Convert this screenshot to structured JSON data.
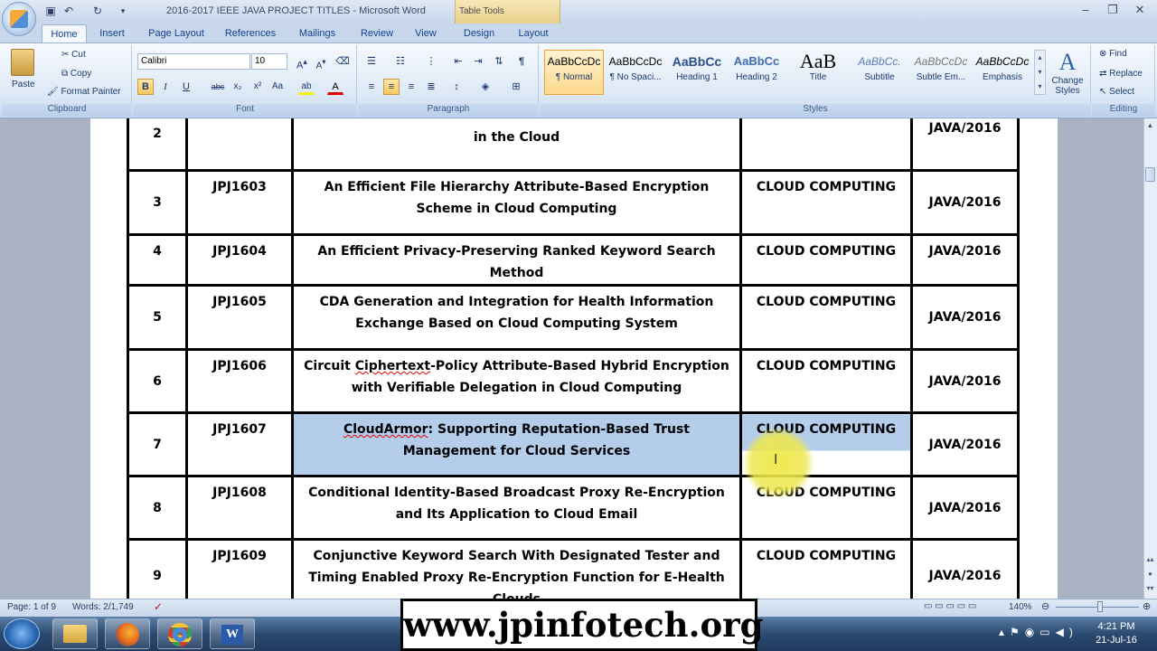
{
  "window": {
    "title": "2016-2017 IEEE JAVA PROJECT TITLES - Microsoft Word",
    "contextual_tab_group": "Table Tools"
  },
  "tabs": [
    "Home",
    "Insert",
    "Page Layout",
    "References",
    "Mailings",
    "Review",
    "View",
    "Design",
    "Layout"
  ],
  "ribbon": {
    "clipboard": {
      "paste": "Paste",
      "cut": "Cut",
      "copy": "Copy",
      "format_painter": "Format Painter",
      "label": "Clipboard"
    },
    "font": {
      "name": "Calibri",
      "size": "10",
      "label": "Font"
    },
    "paragraph": {
      "label": "Paragraph"
    },
    "styles": {
      "label": "Styles",
      "items": [
        {
          "sample": "AaBbCcDc",
          "name": "¶ Normal"
        },
        {
          "sample": "AaBbCcDc",
          "name": "¶ No Spaci..."
        },
        {
          "sample": "AaBbCc",
          "name": "Heading 1"
        },
        {
          "sample": "AaBbCc",
          "name": "Heading 2"
        },
        {
          "sample": "AaB",
          "name": "Title"
        },
        {
          "sample": "AaBbCc.",
          "name": "Subtitle"
        },
        {
          "sample": "AaBbCcDc",
          "name": "Subtle Em..."
        },
        {
          "sample": "AaBbCcDc",
          "name": "Emphasis"
        }
      ],
      "change_styles": "Change Styles"
    },
    "editing": {
      "find": "Find",
      "replace": "Replace",
      "select": "Select",
      "label": "Editing"
    }
  },
  "table": {
    "top_row": {
      "sno": "2",
      "title_line2": "in the Cloud",
      "lang": "JAVA/2016"
    },
    "rows": [
      {
        "sno": "3",
        "code": "JPJ1603",
        "title": "An Efficient File Hierarchy Attribute-Based Encryption Scheme in Cloud Computing",
        "domain": "CLOUD COMPUTING",
        "lang": "JAVA/2016"
      },
      {
        "sno": "4",
        "code": "JPJ1604",
        "title": "An Efficient Privacy-Preserving Ranked Keyword Search Method",
        "domain": "CLOUD COMPUTING",
        "lang": "JAVA/2016"
      },
      {
        "sno": "5",
        "code": "JPJ1605",
        "title": "CDA Generation and Integration for Health Information Exchange Based on Cloud Computing System",
        "domain": "CLOUD COMPUTING",
        "lang": "JAVA/2016"
      },
      {
        "sno": "6",
        "code": "JPJ1606",
        "title": "Circuit Ciphertext-Policy Attribute-Based Hybrid Encryption with Verifiable Delegation in Cloud Computing",
        "domain": "CLOUD COMPUTING",
        "lang": "JAVA/2016"
      },
      {
        "sno": "7",
        "code": "JPJ1607",
        "title": "CloudArmor: Supporting Reputation-Based Trust Management for Cloud Services",
        "domain": "CLOUD COMPUTING",
        "lang": "JAVA/2016"
      },
      {
        "sno": "8",
        "code": "JPJ1608",
        "title": "Conditional Identity-Based Broadcast Proxy Re-Encryption and Its Application to Cloud Email",
        "domain": "CLOUD COMPUTING",
        "lang": "JAVA/2016"
      },
      {
        "sno": "9",
        "code": "JPJ1609",
        "title": "Conjunctive Keyword Search With Designated Tester and Timing Enabled Proxy Re-Encryption Function for E-Health Clouds",
        "domain": "CLOUD COMPUTING",
        "lang": "JAVA/2016"
      }
    ]
  },
  "status": {
    "page": "Page: 1 of 9",
    "words": "Words: 2/1,749",
    "zoom": "140%"
  },
  "banner": "www.jpinfotech.org",
  "clock": {
    "time": "4:21 PM",
    "date": "21-Jul-16"
  }
}
